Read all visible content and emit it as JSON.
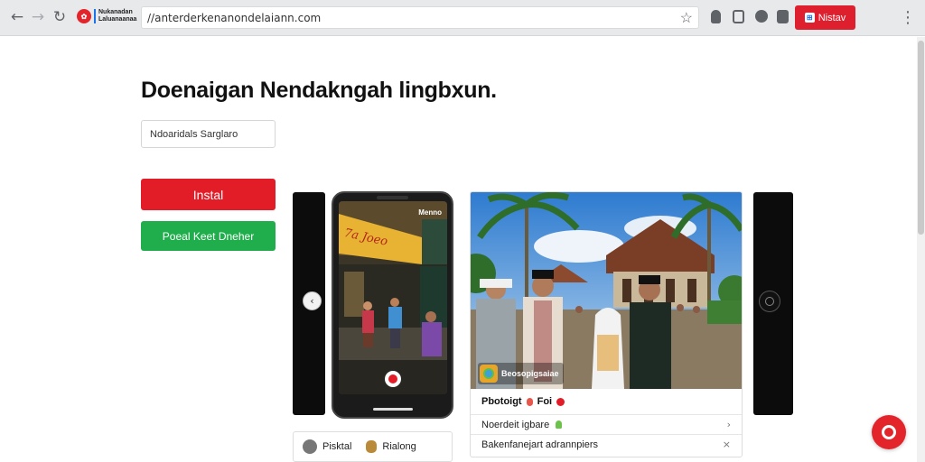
{
  "browser": {
    "tab_title": "Nukanadan Laluanaanaa",
    "url": "//anterderkenanondelaiann.com",
    "install_label": "Nistav"
  },
  "hero": {
    "headline": "Doenaigan Nendakngah lingbxun.",
    "name_input_value": "Ndoaridals Sarglarо",
    "install_button": "Instal",
    "secondary_button": "Poeal Keet Dneher"
  },
  "carousel": {
    "phone_label": "Menno",
    "card": {
      "app_chip": "Beosopigsaiae",
      "title": "Pbotoigt",
      "title_suffix": "Foi",
      "rows": [
        {
          "label": "Noerdeit igbare"
        },
        {
          "label": "Bakenfanejart adrannpiers"
        }
      ]
    },
    "mini_card": {
      "left": "Pisktal",
      "right": "Rialong"
    }
  },
  "colors": {
    "brand_red": "#e31d27",
    "brand_green": "#1fae4b",
    "chrome_bg": "#e8e9eb"
  }
}
